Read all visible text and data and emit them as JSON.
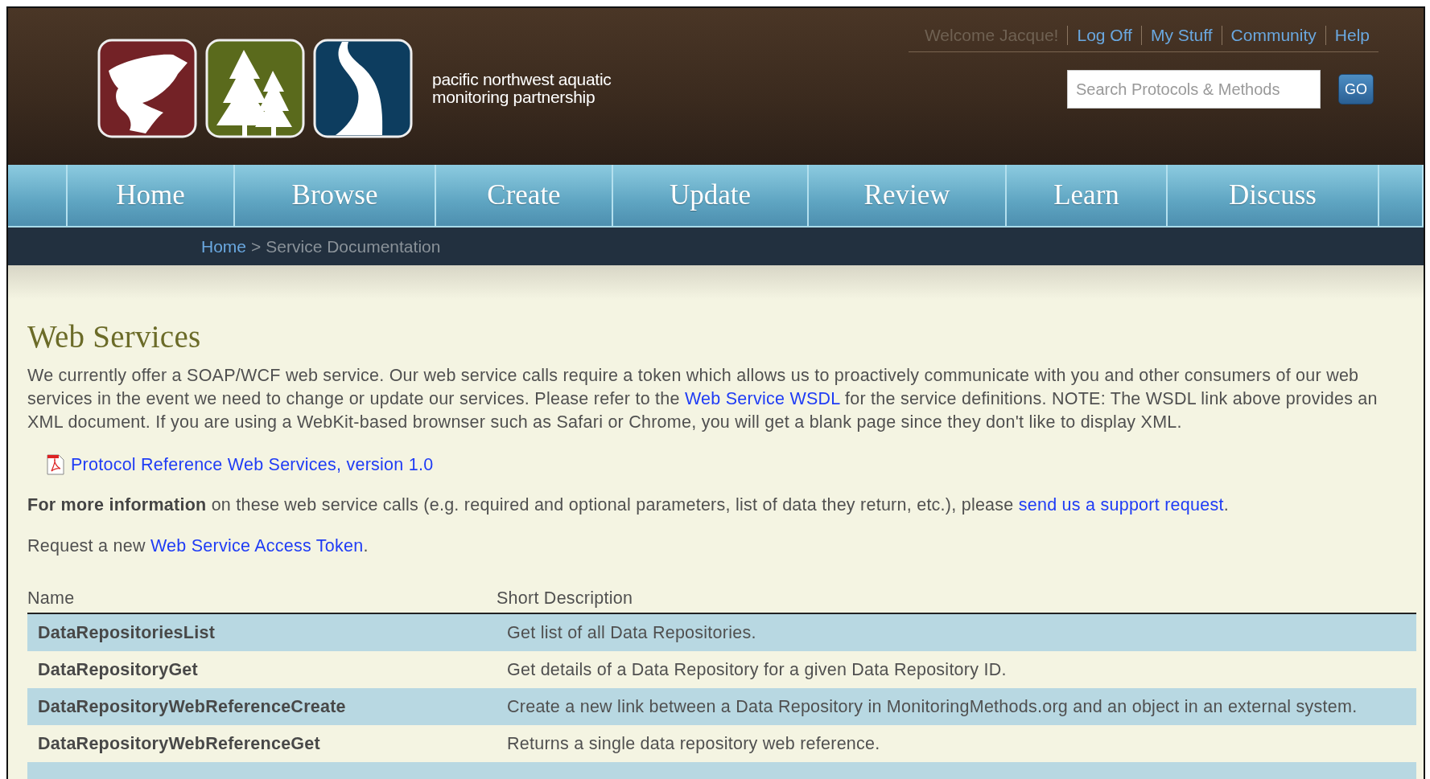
{
  "header": {
    "logo_text": [
      "pacific northwest aquatic",
      "monitoring partnership"
    ],
    "welcome": "Welcome Jacque!",
    "top_links": [
      "Log Off",
      "My Stuff",
      "Community",
      "Help"
    ],
    "search": {
      "placeholder": "Search Protocols & Methods",
      "button": "GO"
    }
  },
  "nav": [
    "Home",
    "Browse",
    "Create",
    "Update",
    "Review",
    "Learn",
    "Discuss"
  ],
  "breadcrumb": {
    "link": "Home",
    "separator": ">",
    "current": "Service Documentation"
  },
  "heading": "Web Services",
  "intro": [
    {
      "kind": "text",
      "text": "We currently offer a SOAP/WCF web service. Our web service calls require a token which allows us to proactively communicate with you and other consumers of our web services in the event we need to change or update our services. Please refer to the "
    },
    {
      "kind": "link",
      "text": "Web Service WSDL"
    },
    {
      "kind": "text",
      "text": " for the service definitions. NOTE: The WSDL link above provides an XML document. If you are using a WebKit-based brownser such as Safari or Chrome, you will get a blank page since they don't like to display XML."
    }
  ],
  "document_link": "Protocol Reference Web Services, version 1.0",
  "more_info": [
    {
      "kind": "bold",
      "text": "For more information"
    },
    {
      "kind": "text",
      "text": " on these web service calls (e.g. required and optional parameters, list of data they return, etc.), please "
    },
    {
      "kind": "link",
      "text": "send us a support request"
    },
    {
      "kind": "text",
      "text": "."
    }
  ],
  "token_request": [
    {
      "kind": "text",
      "text": "Request a new "
    },
    {
      "kind": "link",
      "text": "Web Service Access Token"
    },
    {
      "kind": "text",
      "text": "."
    }
  ],
  "table": {
    "columns": [
      "Name",
      "Short Description"
    ],
    "rows": [
      {
        "name": "DataRepositoriesList",
        "description": "Get list of all Data Repositories."
      },
      {
        "name": "DataRepositoryGet",
        "description": "Get details of a Data Repository for a given Data Repository ID."
      },
      {
        "name": "DataRepositoryWebReferenceCreate",
        "description": "Create a new link between a Data Repository in MonitoringMethods.org and an object in an external system."
      },
      {
        "name": "DataRepositoryWebReferenceGet",
        "description": "Returns a single data repository web reference."
      }
    ]
  }
}
